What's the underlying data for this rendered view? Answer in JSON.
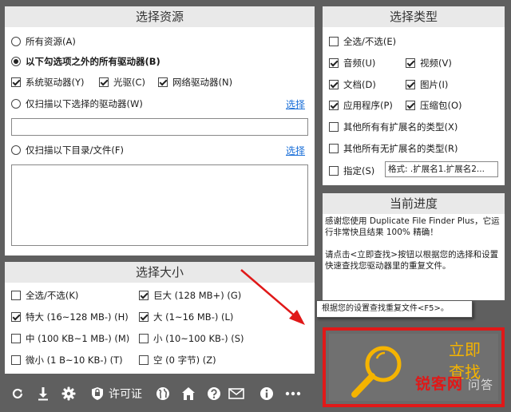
{
  "source_panel": {
    "title": "选择资源",
    "all_resources": "所有资源(A)",
    "except_drives": "以下勾选项之外的所有驱动器(B)",
    "system_drives": "系统驱动器(Y)",
    "optical_drives": "光驱(C)",
    "network_drives": "网络驱动器(N)",
    "only_selected_drives": "仅扫描以下选择的驱动器(W)",
    "select_link_1": "选择",
    "drives_value": "",
    "only_dirs": "仅扫描以下目录/文件(F)",
    "select_link_2": "选择",
    "dirs_value": ""
  },
  "type_panel": {
    "title": "选择类型",
    "select_all": "全选/不选(E)",
    "audio": "音频(U)",
    "video": "视频(V)",
    "document": "文档(D)",
    "image": "图片(I)",
    "app": "应用程序(P)",
    "archive": "压缩包(O)",
    "other_ext": "其他所有有扩展名的类型(X)",
    "other_no_ext": "其他所有无扩展名的类型(R)",
    "specify": "指定(S)",
    "specify_value": "格式: .扩展名1.扩展名2..."
  },
  "progress_panel": {
    "title": "当前进度",
    "text1": "感谢您使用 Duplicate File Finder Plus，它运行非常快且结果 100% 精确！",
    "text2": "请点击<立即查找>按钮以根据您的选择和设置快速查找您驱动器里的重复文件。"
  },
  "size_panel": {
    "title": "选择大小",
    "select_all": "全选/不选(K)",
    "huge": "巨大 (128 MB+) (G)",
    "extra_large": "特大 (16~128 MB-) (H)",
    "large": "大 (1~16 MB-) (L)",
    "medium": "中 (100 KB~1 MB-) (M)",
    "small": "小 (10~100 KB-) (S)",
    "tiny": "微小 (1 B~10 KB-) (T)",
    "empty": "空 (0 字节) (Z)"
  },
  "toolbar": {
    "license": "许可证"
  },
  "tooltip": "根据您的设置查找重复文件<F5>。",
  "find_button": {
    "line1": "立即",
    "line2": "查找"
  },
  "watermark": {
    "main": "锐客网",
    "sub": "问答"
  },
  "colors": {
    "accent": "#f5b400",
    "highlight": "#e01818",
    "link": "#1a6fd8",
    "background": "#5f5f5f"
  }
}
